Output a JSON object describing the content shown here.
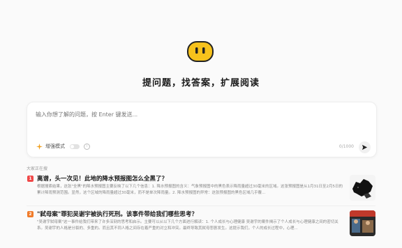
{
  "hero": {
    "headline": "提问题，找答案，扩展阅读"
  },
  "search": {
    "placeholder": "输入你想了解的问题，按 Enter 键发送...",
    "enhance_label": "增强模式",
    "counter": "0/1000"
  },
  "trending": {
    "title": "大家正在搜",
    "items": [
      {
        "rank": "1",
        "rank_color": "#f04848",
        "title": "离谱，头一次见！此地的降水预报图怎么全黑了？",
        "desc": "根据搜索结果，这张\"全黑\"的降水预报图主要反映了以下几个信息：1. 降水预报图的含义：气象预报图中的黑色表示降雨量超过30毫米的区域。这张预报图是从1月31日至2月5日的累计降雨预测范围。显然，这个区域的降雨量超过30毫米，而不是单次降雨量。2. 降水预报图的异常：这张预报图的黑色区域几乎覆..."
      },
      {
        "rank": "2",
        "rank_color": "#f07b2a",
        "title": "\"弑母案\"罪犯吴谢宇被执行死刑。该事件带给我们哪些思考？",
        "desc": "\"吴谢宇弑母案\"这一事件给我们带来了许多深刻的思考和启示。主要可以从以下几个方面进行解读：1. 个人成长与心理健康 吴谢宇的案件揭示了个人成长与心理健康之间的密切关系。吴谢宇的人格是分裂的、多重的。而且其不同人格之间存在着严重的对立和冲突。最终导致其弑母悲剧发生。这提示我们，个人的成长过程中，心理..."
      }
    ]
  },
  "colors": {
    "logo_yellow": "#f7c21c",
    "accent": "#f04848"
  }
}
